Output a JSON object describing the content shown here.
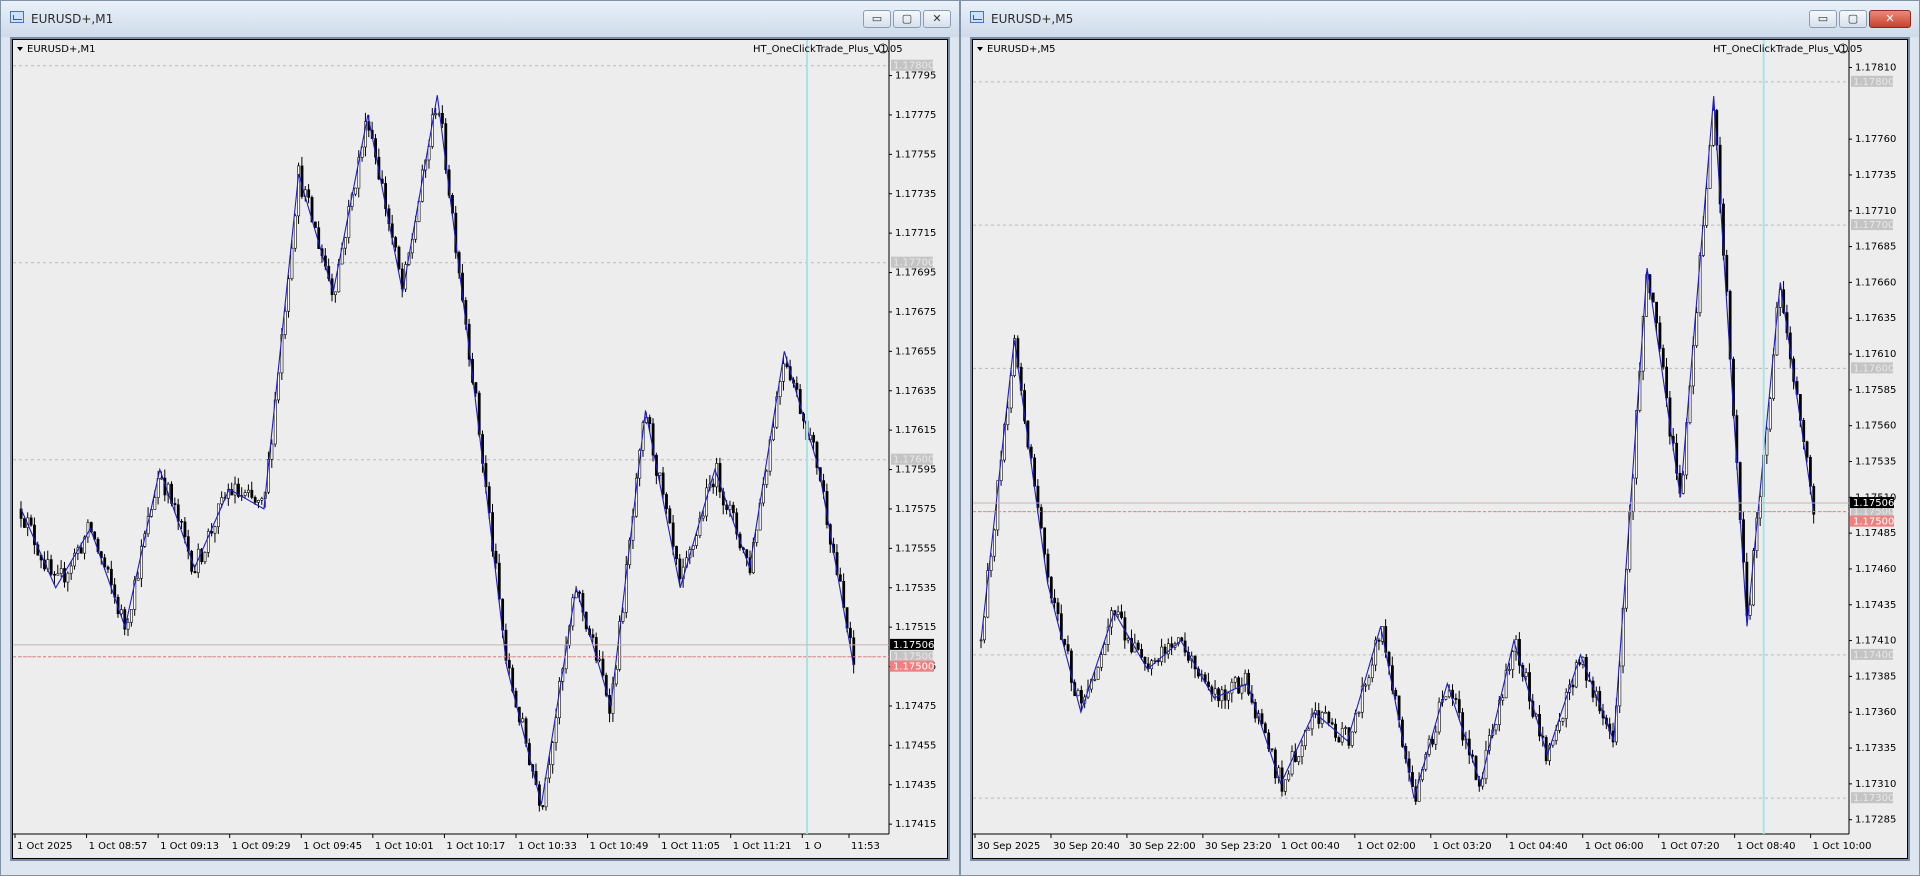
{
  "windows": [
    {
      "title": "EURUSD+,M1",
      "active": false,
      "controls": {
        "minimize": "▭",
        "maximize": "▢",
        "close": "✕"
      }
    },
    {
      "title": "EURUSD+,M5",
      "active": true,
      "controls": {
        "minimize": "▭",
        "maximize": "▢",
        "close": "✕"
      }
    }
  ],
  "chart_data": [
    {
      "type": "candlestick",
      "symbol_label": "EURUSD+,M1",
      "indicator_label": "HT_OneClickTrade_Plus_V1.05",
      "ylim": [
        1.1741,
        1.1781
      ],
      "y_ticks": [
        1.17795,
        1.17775,
        1.17755,
        1.17735,
        1.17715,
        1.17695,
        1.17675,
        1.17655,
        1.17635,
        1.17615,
        1.17595,
        1.17575,
        1.17555,
        1.17535,
        1.17515,
        1.17495,
        1.17475,
        1.17455,
        1.17435,
        1.17415
      ],
      "y_tick_labels": [
        "1.17795",
        "1.17775",
        "1.17755",
        "1.17735",
        "1.17715",
        "1.17695",
        "1.17675",
        "1.17655",
        "1.17635",
        "1.17615",
        "1.17595",
        "1.17575",
        "1.17555",
        "1.17535",
        "1.17515",
        "1.17495",
        "1.17475",
        "1.17455",
        "1.17435",
        "1.17415"
      ],
      "x_tick_labels": [
        "1 Oct 2025",
        "1 Oct 08:57",
        "1 Oct 09:13",
        "1 Oct 09:29",
        "1 Oct 09:45",
        "1 Oct 10:01",
        "1 Oct 10:17",
        "1 Oct 10:33",
        "1 Oct 10:49",
        "1 Oct 11:05",
        "1 Oct 11:21",
        "1 O",
        "11:53"
      ],
      "grid_levels": [
        1.178,
        1.177,
        1.176,
        1.175
      ],
      "grid_level_labels": [
        "1.17800",
        "1.17700",
        "1.17600",
        "1.17500"
      ],
      "bid": 1.17506,
      "bid_label": "1.17506",
      "ask": 1.175,
      "ask_label": "1.17500",
      "zigzag": [
        1.17575,
        1.17535,
        1.17565,
        1.17515,
        1.17595,
        1.17545,
        1.17585,
        1.17575,
        1.17745,
        1.17685,
        1.17775,
        1.17685,
        1.17785,
        1.17645,
        1.17495,
        1.17425,
        1.17535,
        1.17475,
        1.17625,
        1.17535,
        1.17595,
        1.17545,
        1.17655,
        1.17595,
        1.17495
      ],
      "candles": 250,
      "current_bar_fraction": 0.944,
      "colors": {
        "line": "#1c1cc8",
        "bid": "#000000",
        "ask": "#f08080",
        "cursor": "#a8e3e8",
        "grid": "#b8b8b8",
        "bg": "#ededed"
      }
    },
    {
      "type": "candlestick",
      "symbol_label": "EURUSD+,M5",
      "indicator_label": "HT_OneClickTrade_Plus_V1.05",
      "ylim": [
        1.17275,
        1.17825
      ],
      "y_ticks": [
        1.1781,
        1.1776,
        1.17735,
        1.1771,
        1.17685,
        1.1766,
        1.17635,
        1.1761,
        1.17585,
        1.1756,
        1.17535,
        1.1751,
        1.17485,
        1.1746,
        1.17435,
        1.1741,
        1.17385,
        1.1736,
        1.17335,
        1.1731,
        1.17285
      ],
      "y_tick_labels": [
        "1.17810",
        "1.17760",
        "1.17735",
        "1.17710",
        "1.17685",
        "1.17660",
        "1.17635",
        "1.17610",
        "1.17585",
        "1.17560",
        "1.17535",
        "1.17510",
        "1.17485",
        "1.17460",
        "1.17435",
        "1.17410",
        "1.17385",
        "1.17360",
        "1.17335",
        "1.17310",
        "1.17285"
      ],
      "x_tick_labels": [
        "30 Sep 2025",
        "30 Sep 20:40",
        "30 Sep 22:00",
        "30 Sep 23:20",
        "1 Oct 00:40",
        "1 Oct 02:00",
        "1 Oct 03:20",
        "1 Oct 04:40",
        "1 Oct 06:00",
        "1 Oct 07:20",
        "1 Oct 08:40",
        "1 Oct 10:00"
      ],
      "grid_levels": [
        1.178,
        1.177,
        1.176,
        1.175,
        1.174,
        1.173
      ],
      "grid_level_labels": [
        "1.17800",
        "1.17700",
        "1.17600",
        "1.17500",
        "1.17400",
        "1.17300"
      ],
      "bid": 1.17506,
      "bid_label": "1.17506",
      "ask": 1.175,
      "ask_label": "1.17500",
      "zigzag": [
        1.1741,
        1.1762,
        1.1745,
        1.1736,
        1.1743,
        1.1739,
        1.1741,
        1.1737,
        1.1738,
        1.1731,
        1.1736,
        1.1734,
        1.1742,
        1.173,
        1.1738,
        1.1731,
        1.1741,
        1.1733,
        1.174,
        1.1734,
        1.1767,
        1.1751,
        1.1779,
        1.1742,
        1.1766,
        1.175
      ],
      "candles": 250,
      "current_bar_fraction": 0.94,
      "colors": {
        "line": "#1c1cc8",
        "bid": "#000000",
        "ask": "#f08080",
        "cursor": "#a8e3e8",
        "grid": "#b8b8b8",
        "bg": "#ededed"
      }
    }
  ]
}
